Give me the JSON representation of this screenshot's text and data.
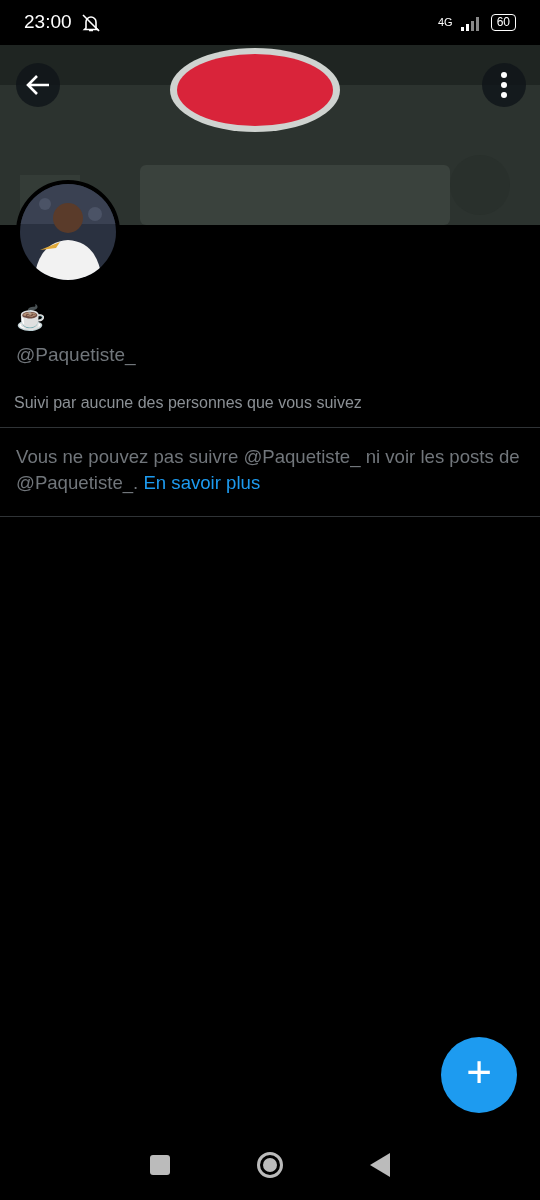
{
  "status_bar": {
    "time": "23:00",
    "network": "4G",
    "battery": "60"
  },
  "profile": {
    "display_name": "☕",
    "handle": "@Paquetiste_",
    "followed_by": "Suivi par aucune des personnes que vous suivez"
  },
  "notice": {
    "text": "Vous ne pouvez pas suivre @Paquetiste_ ni voir les posts de @Paquetiste_.",
    "link": "En savoir plus"
  },
  "fab": {
    "label": "+"
  }
}
